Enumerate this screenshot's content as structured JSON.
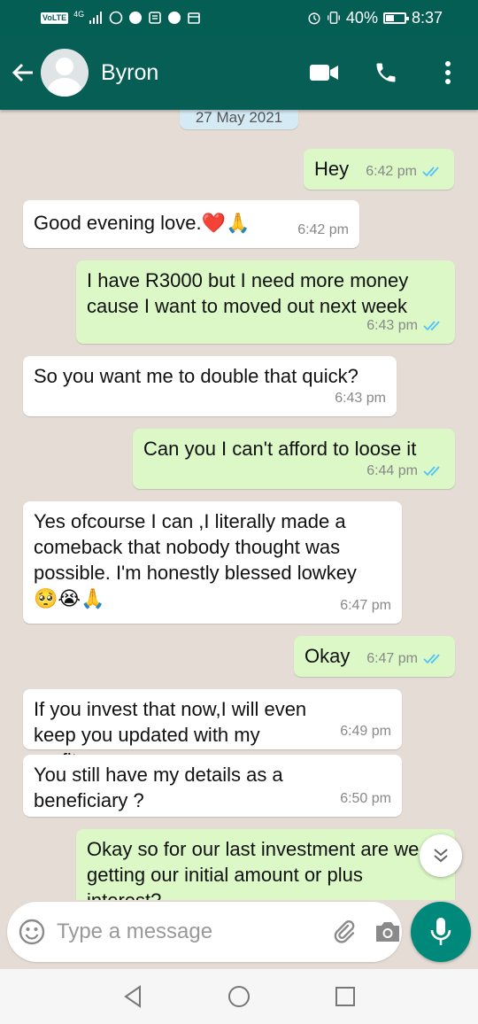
{
  "status_bar": {
    "volte": "VoLTE",
    "network": "4G",
    "battery": "40%",
    "time": "8:37"
  },
  "header": {
    "contact_name": "Byron",
    "icons": [
      "back-arrow-icon",
      "video-call-icon",
      "phone-icon",
      "more-vert-icon"
    ]
  },
  "chat": {
    "date": "27 May 2021",
    "messages": [
      {
        "dir": "out",
        "text": "Hey",
        "time": "6:42 pm",
        "read": true
      },
      {
        "dir": "in",
        "text": "Good evening love.❤️🙏",
        "time": "6:42 pm"
      },
      {
        "dir": "out",
        "text": "I have R3000 but I need more money cause I want to moved out next week",
        "time": "6:43 pm",
        "read": true
      },
      {
        "dir": "in",
        "text": "So you want me to double that quick?",
        "time": "6:43 pm"
      },
      {
        "dir": "out",
        "text": "Can you I can't afford to loose it",
        "time": "6:44 pm",
        "read": true
      },
      {
        "dir": "in",
        "text": "Yes ofcourse I can ,I literally made a comeback that nobody thought was possible.  I'm honestly blessed lowkey🥺😭🙏",
        "time": "6:47 pm"
      },
      {
        "dir": "out",
        "text": "Okay",
        "time": "6:47 pm",
        "read": true
      },
      {
        "dir": "in",
        "text": "If you invest that now,I will even keep you updated with my profits.",
        "time": "6:49 pm"
      },
      {
        "dir": "in",
        "text": "You still have my details as a beneficiary ?",
        "time": "6:50 pm"
      },
      {
        "dir": "out",
        "text": "Okay so for our last investment are we getting our initial amount or plus interest?",
        "time": ""
      }
    ]
  },
  "composer": {
    "placeholder": "Type a message"
  },
  "colors": {
    "header": "#075e54",
    "outgoing_bubble": "#dcf8c6",
    "incoming_bubble": "#ffffff",
    "chat_background": "#e5ddd5",
    "read_ticks": "#4fc3f7",
    "mic_button": "#00897b"
  }
}
